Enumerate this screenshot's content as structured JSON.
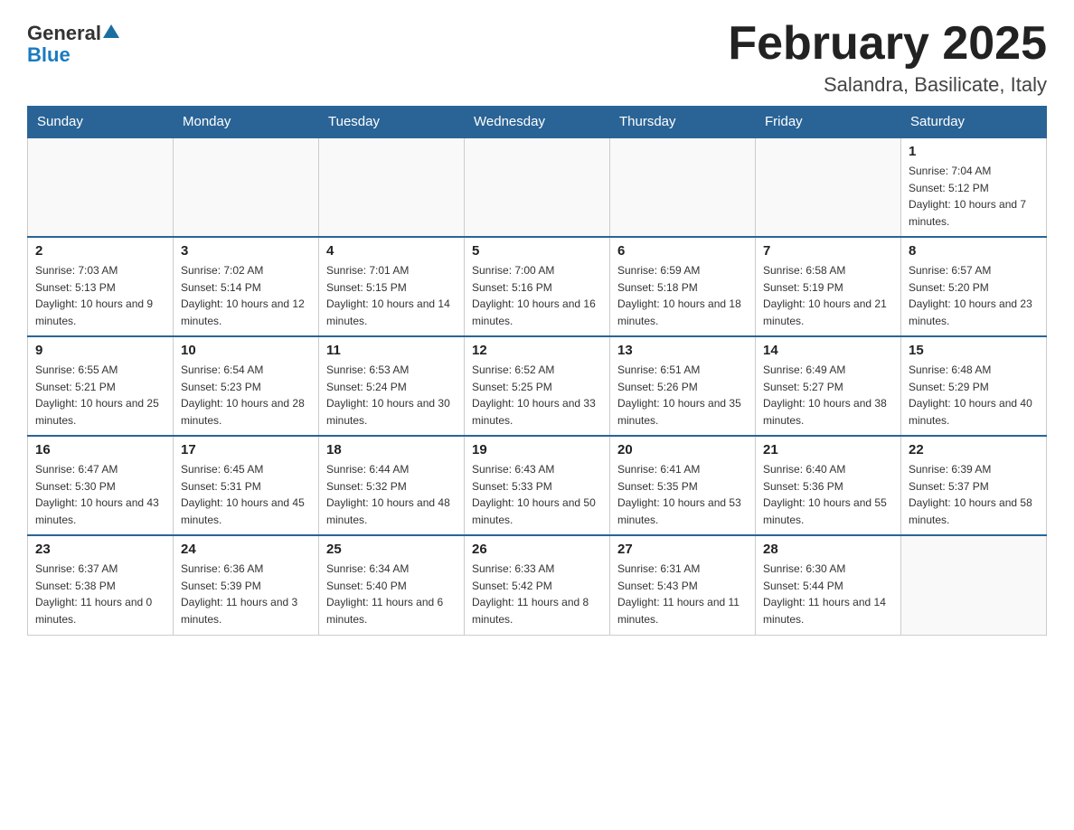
{
  "logo": {
    "general": "General",
    "blue": "Blue"
  },
  "title": "February 2025",
  "subtitle": "Salandra, Basilicate, Italy",
  "days_header": [
    "Sunday",
    "Monday",
    "Tuesday",
    "Wednesday",
    "Thursday",
    "Friday",
    "Saturday"
  ],
  "weeks": [
    [
      {
        "day": "",
        "info": ""
      },
      {
        "day": "",
        "info": ""
      },
      {
        "day": "",
        "info": ""
      },
      {
        "day": "",
        "info": ""
      },
      {
        "day": "",
        "info": ""
      },
      {
        "day": "",
        "info": ""
      },
      {
        "day": "1",
        "info": "Sunrise: 7:04 AM\nSunset: 5:12 PM\nDaylight: 10 hours and 7 minutes."
      }
    ],
    [
      {
        "day": "2",
        "info": "Sunrise: 7:03 AM\nSunset: 5:13 PM\nDaylight: 10 hours and 9 minutes."
      },
      {
        "day": "3",
        "info": "Sunrise: 7:02 AM\nSunset: 5:14 PM\nDaylight: 10 hours and 12 minutes."
      },
      {
        "day": "4",
        "info": "Sunrise: 7:01 AM\nSunset: 5:15 PM\nDaylight: 10 hours and 14 minutes."
      },
      {
        "day": "5",
        "info": "Sunrise: 7:00 AM\nSunset: 5:16 PM\nDaylight: 10 hours and 16 minutes."
      },
      {
        "day": "6",
        "info": "Sunrise: 6:59 AM\nSunset: 5:18 PM\nDaylight: 10 hours and 18 minutes."
      },
      {
        "day": "7",
        "info": "Sunrise: 6:58 AM\nSunset: 5:19 PM\nDaylight: 10 hours and 21 minutes."
      },
      {
        "day": "8",
        "info": "Sunrise: 6:57 AM\nSunset: 5:20 PM\nDaylight: 10 hours and 23 minutes."
      }
    ],
    [
      {
        "day": "9",
        "info": "Sunrise: 6:55 AM\nSunset: 5:21 PM\nDaylight: 10 hours and 25 minutes."
      },
      {
        "day": "10",
        "info": "Sunrise: 6:54 AM\nSunset: 5:23 PM\nDaylight: 10 hours and 28 minutes."
      },
      {
        "day": "11",
        "info": "Sunrise: 6:53 AM\nSunset: 5:24 PM\nDaylight: 10 hours and 30 minutes."
      },
      {
        "day": "12",
        "info": "Sunrise: 6:52 AM\nSunset: 5:25 PM\nDaylight: 10 hours and 33 minutes."
      },
      {
        "day": "13",
        "info": "Sunrise: 6:51 AM\nSunset: 5:26 PM\nDaylight: 10 hours and 35 minutes."
      },
      {
        "day": "14",
        "info": "Sunrise: 6:49 AM\nSunset: 5:27 PM\nDaylight: 10 hours and 38 minutes."
      },
      {
        "day": "15",
        "info": "Sunrise: 6:48 AM\nSunset: 5:29 PM\nDaylight: 10 hours and 40 minutes."
      }
    ],
    [
      {
        "day": "16",
        "info": "Sunrise: 6:47 AM\nSunset: 5:30 PM\nDaylight: 10 hours and 43 minutes."
      },
      {
        "day": "17",
        "info": "Sunrise: 6:45 AM\nSunset: 5:31 PM\nDaylight: 10 hours and 45 minutes."
      },
      {
        "day": "18",
        "info": "Sunrise: 6:44 AM\nSunset: 5:32 PM\nDaylight: 10 hours and 48 minutes."
      },
      {
        "day": "19",
        "info": "Sunrise: 6:43 AM\nSunset: 5:33 PM\nDaylight: 10 hours and 50 minutes."
      },
      {
        "day": "20",
        "info": "Sunrise: 6:41 AM\nSunset: 5:35 PM\nDaylight: 10 hours and 53 minutes."
      },
      {
        "day": "21",
        "info": "Sunrise: 6:40 AM\nSunset: 5:36 PM\nDaylight: 10 hours and 55 minutes."
      },
      {
        "day": "22",
        "info": "Sunrise: 6:39 AM\nSunset: 5:37 PM\nDaylight: 10 hours and 58 minutes."
      }
    ],
    [
      {
        "day": "23",
        "info": "Sunrise: 6:37 AM\nSunset: 5:38 PM\nDaylight: 11 hours and 0 minutes."
      },
      {
        "day": "24",
        "info": "Sunrise: 6:36 AM\nSunset: 5:39 PM\nDaylight: 11 hours and 3 minutes."
      },
      {
        "day": "25",
        "info": "Sunrise: 6:34 AM\nSunset: 5:40 PM\nDaylight: 11 hours and 6 minutes."
      },
      {
        "day": "26",
        "info": "Sunrise: 6:33 AM\nSunset: 5:42 PM\nDaylight: 11 hours and 8 minutes."
      },
      {
        "day": "27",
        "info": "Sunrise: 6:31 AM\nSunset: 5:43 PM\nDaylight: 11 hours and 11 minutes."
      },
      {
        "day": "28",
        "info": "Sunrise: 6:30 AM\nSunset: 5:44 PM\nDaylight: 11 hours and 14 minutes."
      },
      {
        "day": "",
        "info": ""
      }
    ]
  ]
}
